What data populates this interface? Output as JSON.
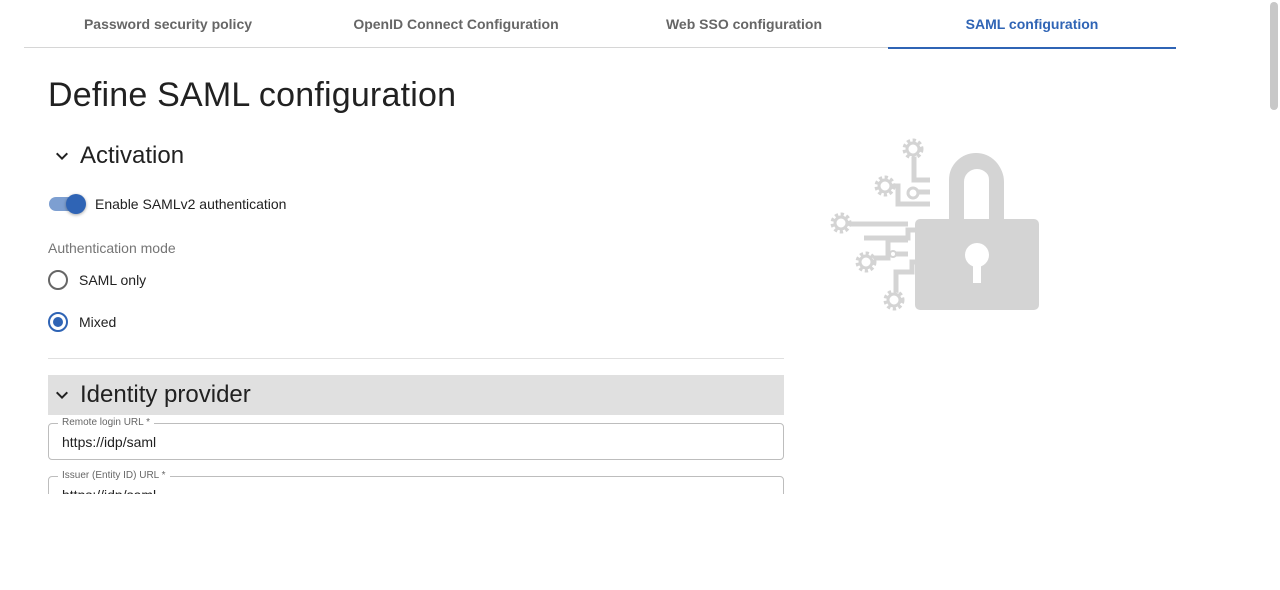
{
  "tabs": [
    {
      "label": "Password security policy"
    },
    {
      "label": "OpenID Connect Configuration"
    },
    {
      "label": "Web SSO configuration"
    },
    {
      "label": "SAML configuration"
    }
  ],
  "active_tab": "SAML configuration",
  "page_title": "Define SAML configuration",
  "activation": {
    "title": "Activation",
    "toggle_label": "Enable SAMLv2 authentication",
    "toggle_on": true,
    "mode_label": "Authentication mode",
    "options": [
      {
        "label": "SAML only",
        "checked": false
      },
      {
        "label": "Mixed",
        "checked": true
      }
    ]
  },
  "identity_provider": {
    "title": "Identity provider",
    "fields": [
      {
        "label": "Remote login URL *",
        "value": "https://idp/saml"
      },
      {
        "label": "Issuer (Entity ID) URL *",
        "value": "https://idp/saml"
      }
    ]
  },
  "colors": {
    "accent": "#2f64b5",
    "section_header_bg": "#e0e0e0",
    "illustration": "#d4d4d4"
  },
  "icons": {
    "section_toggle": "chevron-down-icon",
    "illustration": "padlock-with-gears-illustration"
  }
}
